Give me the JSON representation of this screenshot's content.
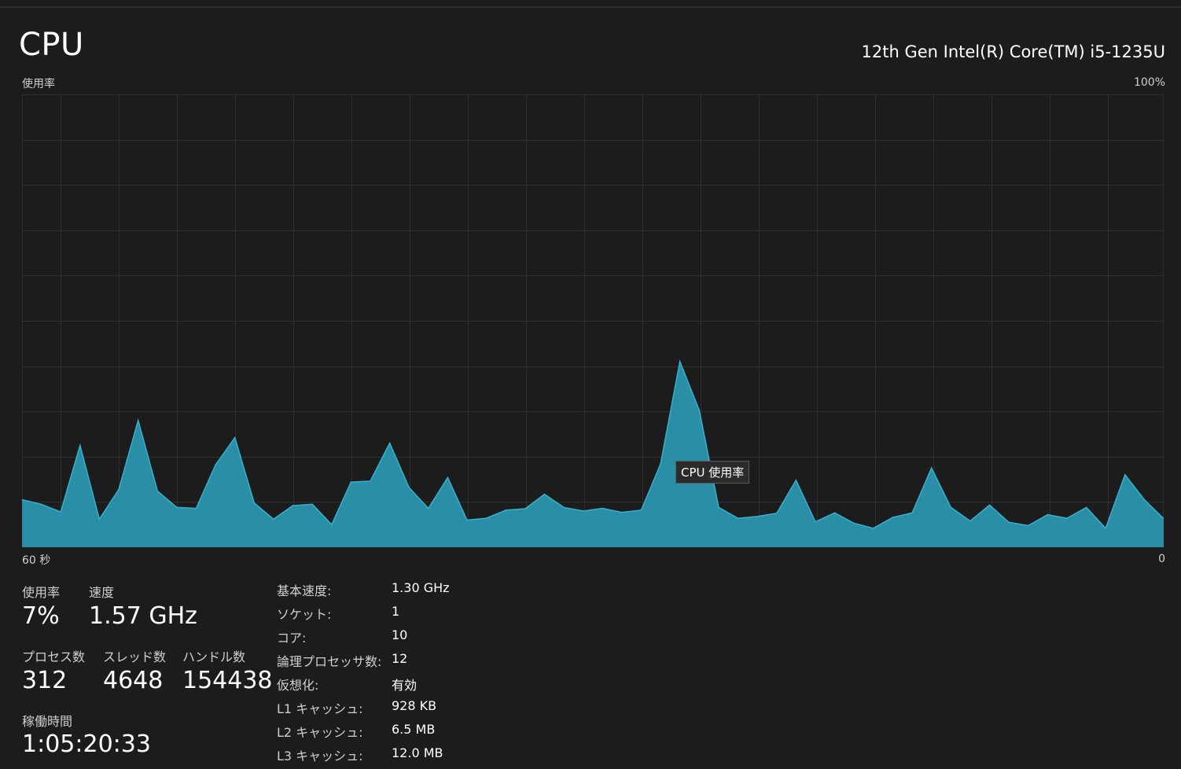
{
  "header": {
    "title": "CPU",
    "cpu_model": "12th Gen Intel(R) Core(TM) i5-1235U"
  },
  "graph": {
    "y_label": "使用率",
    "y_max_label": "100%",
    "x_left_label": "60 秒",
    "x_right_label": "0",
    "tooltip": "CPU 使用率",
    "fill_color": "#2a8ea6",
    "line_color": "#36b0cc",
    "grid_color": "#2f2f2f"
  },
  "chart_data": {
    "type": "area",
    "xlabel": "",
    "ylabel": "使用率",
    "xlim": [
      60,
      0
    ],
    "ylim": [
      0,
      100
    ],
    "grid": true,
    "series": [
      {
        "values": [
          10.5,
          9.5,
          7.8,
          22.5,
          6.2,
          12.8,
          28,
          12.4,
          8.8,
          8.6,
          18.2,
          24.2,
          9.8,
          6.2,
          9.2,
          9.5,
          5,
          14.4,
          14.6,
          23,
          13.2,
          8.6,
          15.4,
          6,
          6.4,
          8.2,
          8.5,
          11.7,
          8.8,
          8,
          8.6,
          7.7,
          8.2,
          18.4,
          41,
          30.2,
          8.8,
          6.4,
          6.8,
          7.5,
          14.8,
          5.6,
          7.6,
          5.3,
          4.2,
          6.6,
          7.6,
          17.5,
          8.8,
          5.8,
          9.3,
          5.5,
          4.8,
          7.2,
          6.4,
          8.8,
          4.2,
          16,
          10.5,
          6.3
        ]
      }
    ]
  },
  "stats": {
    "usage_label": "使用率",
    "usage_value": "7%",
    "speed_label": "速度",
    "speed_value": "1.57 GHz",
    "processes_label": "プロセス数",
    "processes_value": "312",
    "threads_label": "スレッド数",
    "threads_value": "4648",
    "handles_label": "ハンドル数",
    "handles_value": "154438",
    "uptime_label": "稼働時間",
    "uptime_value": "1:05:20:33"
  },
  "info": [
    {
      "key": "基本速度:",
      "value": "1.30 GHz"
    },
    {
      "key": "ソケット:",
      "value": "1"
    },
    {
      "key": "コア:",
      "value": "10"
    },
    {
      "key": "論理プロセッサ数:",
      "value": "12"
    },
    {
      "key": "仮想化:",
      "value": "有効"
    },
    {
      "key": "L1 キャッシュ:",
      "value": "928 KB"
    },
    {
      "key": "L2 キャッシュ:",
      "value": "6.5 MB"
    },
    {
      "key": "L3 キャッシュ:",
      "value": "12.0 MB"
    }
  ]
}
